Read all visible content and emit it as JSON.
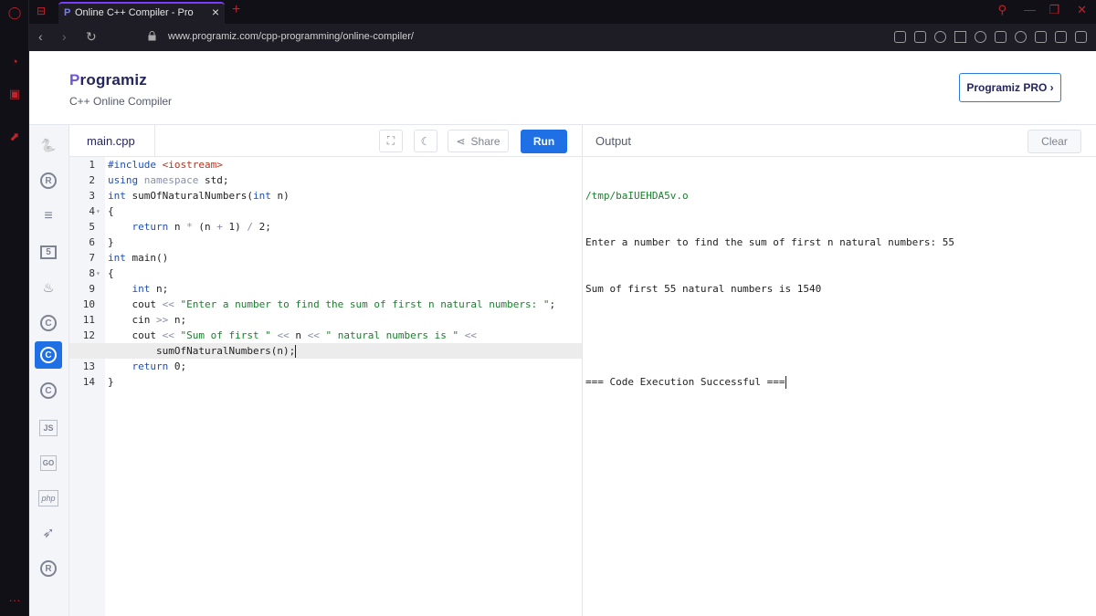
{
  "browser": {
    "tab_title": "Online C++ Compiler - Pro",
    "tab_favicon": "P",
    "url": "www.programiz.com/cpp-programming/online-compiler/",
    "accent": "#c0232b"
  },
  "header": {
    "logo_p": "P",
    "logo_rest": "rogramiz",
    "subtitle": "C++ Online Compiler",
    "pro_button": "Programiz PRO ›"
  },
  "languages": [
    {
      "icon": "python-icon",
      "glyph": "🐍"
    },
    {
      "icon": "r-icon",
      "glyph": "R"
    },
    {
      "icon": "sql-icon",
      "glyph": "≡"
    },
    {
      "icon": "html5-icon",
      "glyph": "5"
    },
    {
      "icon": "java-icon",
      "glyph": "♨"
    },
    {
      "icon": "c-icon",
      "glyph": "C"
    },
    {
      "icon": "cpp-icon",
      "glyph": "C"
    },
    {
      "icon": "csharp-icon",
      "glyph": "C"
    },
    {
      "icon": "js-icon",
      "glyph": "JS"
    },
    {
      "icon": "go-icon",
      "glyph": "GO"
    },
    {
      "icon": "php-icon",
      "glyph": "php"
    },
    {
      "icon": "swift-icon",
      "glyph": "➶"
    },
    {
      "icon": "rust-icon",
      "glyph": "R"
    }
  ],
  "editor": {
    "file_name": "main.cpp",
    "share_label": "Share",
    "run_label": "Run",
    "line_numbers": [
      "1",
      "2",
      "3",
      "4",
      "5",
      "6",
      "7",
      "8",
      "9",
      "10",
      "11",
      "12",
      "",
      "13",
      "14"
    ]
  },
  "output": {
    "title": "Output",
    "clear_label": "Clear",
    "lines": [
      "/tmp/baIUEHDA5v.o",
      "Enter a number to find the sum of first n natural numbers: 55",
      "Sum of first 55 natural numbers is 1540",
      "",
      "=== Code Execution Successful ==="
    ]
  }
}
